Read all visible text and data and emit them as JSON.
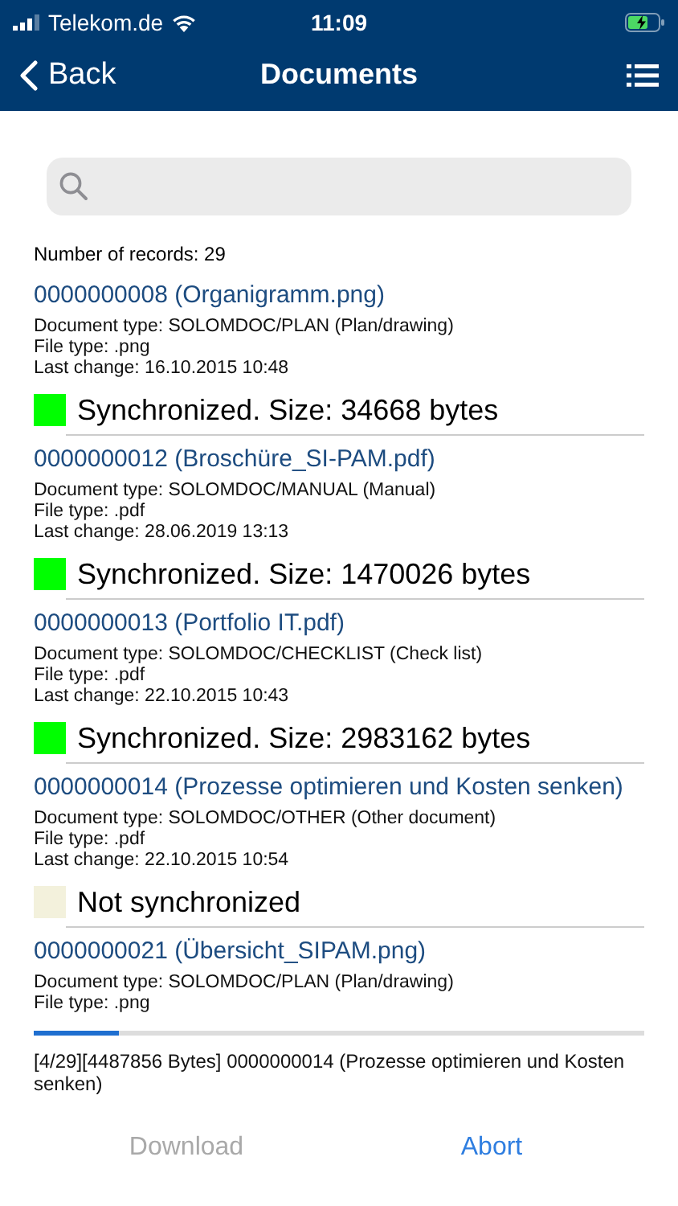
{
  "status_bar": {
    "carrier": "Telekom.de",
    "time": "11:09"
  },
  "nav": {
    "back": "Back",
    "title": "Documents"
  },
  "record_count": "Number of records: 29",
  "documents": [
    {
      "title": "0000000008 (Organigramm.png)",
      "document_type": "Document type: SOLOMDOC/PLAN (Plan/drawing)",
      "file_type": "File type: .png",
      "last_change": "Last change: 16.10.2015 10:48",
      "synchronized": true,
      "status": "Synchronized. Size: 34668 bytes"
    },
    {
      "title": "0000000012 (Broschüre_SI-PAM.pdf)",
      "document_type": "Document type: SOLOMDOC/MANUAL (Manual)",
      "file_type": "File type: .pdf",
      "last_change": "Last change: 28.06.2019 13:13",
      "synchronized": true,
      "status": "Synchronized. Size: 1470026 bytes"
    },
    {
      "title": "0000000013 (Portfolio IT.pdf)",
      "document_type": "Document type: SOLOMDOC/CHECKLIST (Check list)",
      "file_type": "File type: .pdf",
      "last_change": "Last change: 22.10.2015 10:43",
      "synchronized": true,
      "status": "Synchronized. Size: 2983162 bytes"
    },
    {
      "title": "0000000014 (Prozesse optimieren und Kosten senken)",
      "document_type": "Document type: SOLOMDOC/OTHER (Other document)",
      "file_type": "File type: .pdf",
      "last_change": "Last change: 22.10.2015 10:54",
      "synchronized": false,
      "status": "Not synchronized"
    },
    {
      "title": "0000000021 (Übersicht_SIPAM.png)",
      "document_type": "Document type: SOLOMDOC/PLAN (Plan/drawing)",
      "file_type": "File type: .png"
    }
  ],
  "progress": {
    "level": 0.14,
    "message": "[4/29][4487856 Bytes] 0000000014 (Prozesse optimieren und Kosten senken)"
  },
  "buttons": [
    {
      "label": "Download",
      "disabled": true
    },
    {
      "label": "Abort",
      "disabled": false
    }
  ]
}
